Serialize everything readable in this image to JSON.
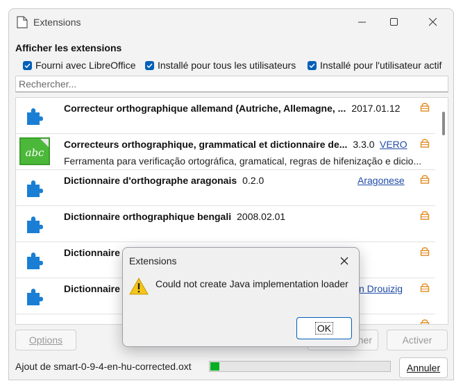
{
  "window": {
    "title": "Extensions",
    "section_title": "Afficher les extensions",
    "filters": [
      {
        "label": "Fourni avec LibreOffice",
        "checked": true
      },
      {
        "label": "Installé pour tous les utilisateurs",
        "checked": true
      },
      {
        "label": "Installé pour l'utilisateur actif",
        "checked": true
      }
    ],
    "search_placeholder": "Rechercher...",
    "extensions": [
      {
        "name": "Correcteur orthographique allemand (Autriche, Allemagne, ...",
        "version": "2017.01.12",
        "publisher": "",
        "description": "",
        "icon": "puzzle-icon"
      },
      {
        "name": "Correcteurs orthographique, grammatical et dictionnaire de...",
        "version": "3.3.0",
        "publisher": "VERO",
        "description": "Ferramenta para verificação ortográfica, gramatical, regras de hifenização e dicio...",
        "icon": "abc-icon"
      },
      {
        "name": "Dictionnaire d'orthographe aragonais",
        "version": "0.2.0",
        "publisher": "Aragonese",
        "description": "",
        "icon": "puzzle-icon"
      },
      {
        "name": "Dictionnaire orthographique bengali",
        "version": "2008.02.01",
        "publisher": "",
        "description": "",
        "icon": "puzzle-icon"
      },
      {
        "name": "Dictionnaire",
        "version": "",
        "publisher": "",
        "description": "",
        "icon": "puzzle-icon"
      },
      {
        "name": "Dictionnaire",
        "version": "",
        "publisher": "n Drouizig",
        "description": "",
        "icon": "puzzle-icon"
      }
    ],
    "buttons": {
      "options": "Options",
      "remove_partial": "ner",
      "activate": "Activer",
      "cancel": "Annuler"
    },
    "status_text": "Ajout de smart-0-9-4-en-hu-corrected.oxt",
    "progress_fraction": 0.05
  },
  "dialog": {
    "title": "Extensions",
    "message": "Could not create Java implementation loader",
    "ok_label": "OK"
  },
  "colors": {
    "accent": "#005fb8",
    "link": "#1f4aa8",
    "progress": "#06b025",
    "lock": "#e08a1e",
    "puzzle": "#1a7fd4"
  }
}
